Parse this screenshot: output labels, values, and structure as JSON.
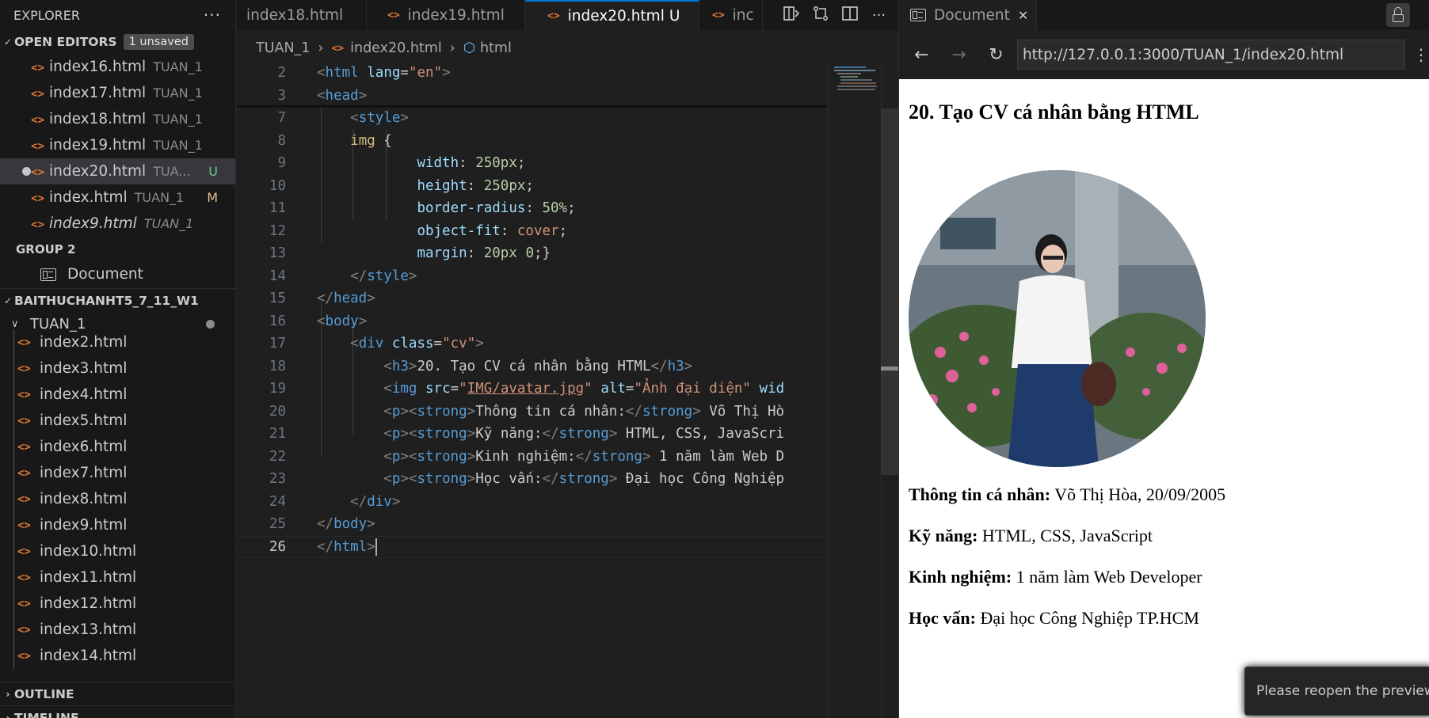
{
  "sidebar": {
    "title": "EXPLORER",
    "more": "···",
    "open_editors": {
      "label": "OPEN EDITORS",
      "badge": "1 unsaved",
      "items": [
        {
          "name": "index16.html",
          "desc": "TUAN_1",
          "status": ""
        },
        {
          "name": "index17.html",
          "desc": "TUAN_1",
          "status": ""
        },
        {
          "name": "index18.html",
          "desc": "TUAN_1",
          "status": ""
        },
        {
          "name": "index19.html",
          "desc": "TUAN_1",
          "status": ""
        },
        {
          "name": "index20.html",
          "desc": "TUA...",
          "status": "U"
        },
        {
          "name": "index.html",
          "desc": "TUAN_1",
          "status": "M"
        },
        {
          "name": "index9.html",
          "desc": "TUAN_1",
          "status": ""
        }
      ],
      "group2_label": "GROUP 2",
      "group2_item": "Document"
    },
    "workspace": {
      "label": "BAITHUCHANHT5_7_11_W1",
      "folder": "TUAN_1",
      "files": [
        "index2.html",
        "index3.html",
        "index4.html",
        "index5.html",
        "index6.html",
        "index7.html",
        "index8.html",
        "index9.html",
        "index10.html",
        "index11.html",
        "index12.html",
        "index13.html",
        "index14.html"
      ]
    },
    "outline": "OUTLINE",
    "timeline": "TIMELINE"
  },
  "editor": {
    "tabs": [
      {
        "label": "index18.html"
      },
      {
        "label": "index19.html"
      },
      {
        "label": "index20.html",
        "status": "U"
      },
      {
        "label": "inc"
      }
    ],
    "breadcrumb": {
      "folder": "TUAN_1",
      "file": "index20.html",
      "symbol": "html"
    },
    "line_numbers": [
      "2",
      "3",
      "7",
      "8",
      "9",
      "10",
      "11",
      "12",
      "13",
      "14",
      "15",
      "16",
      "17",
      "18",
      "19",
      "20",
      "21",
      "22",
      "23",
      "24",
      "25",
      "26"
    ]
  },
  "preview": {
    "tab": "Document",
    "url": "http://127.0.0.1:3000/TUAN_1/index20.html",
    "page": {
      "heading": "20. Tạo CV cá nhân bằng HTML",
      "rows": [
        {
          "label": "Thông tin cá nhân:",
          "value": " Võ Thị Hòa, 20/09/2005"
        },
        {
          "label": "Kỹ năng:",
          "value": " HTML, CSS, JavaScript"
        },
        {
          "label": "Kinh nghiệm:",
          "value": " 1 năm làm Web Developer"
        },
        {
          "label": "Học vấn:",
          "value": " Đại học Công Nghiệp TP.HCM"
        }
      ]
    },
    "toast": "Please reopen the preview."
  },
  "colors": {
    "accent": "#0078d4",
    "html_icon": "#e37933",
    "tag": "#569cd6",
    "attr": "#9cdcfe",
    "string": "#ce9178",
    "number": "#b5cea8",
    "selector": "#d7ba7d"
  }
}
